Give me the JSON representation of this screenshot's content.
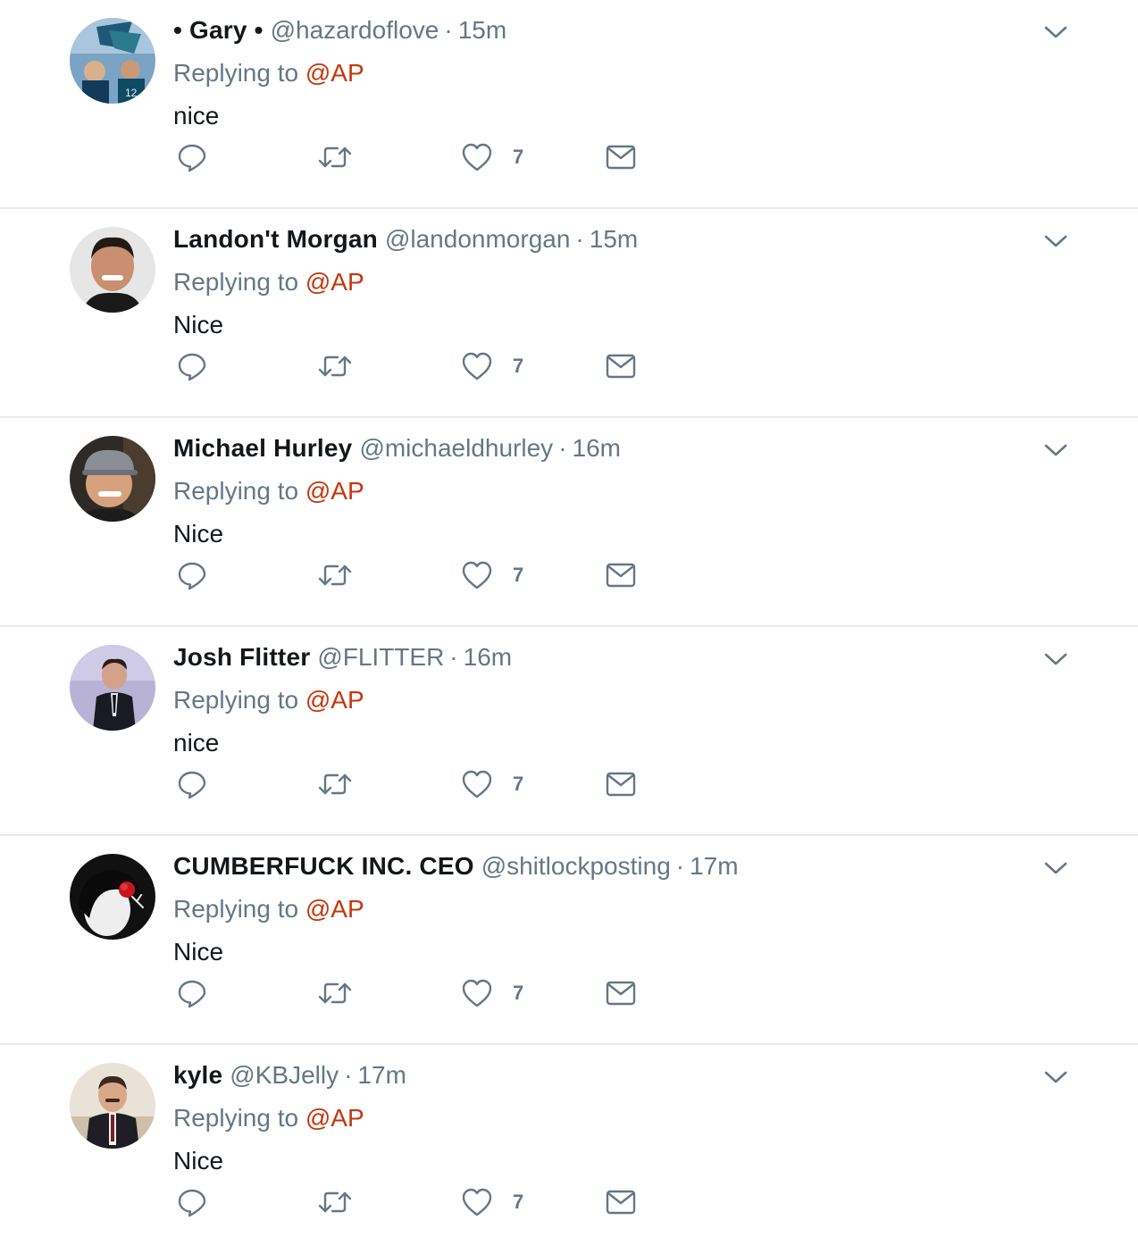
{
  "colors": {
    "name": "#14171a",
    "meta": "#657786",
    "mention": "#c6360b",
    "divider": "#e6ecf0",
    "icon": "#657786"
  },
  "icons": {
    "caret": "chevron-down-icon",
    "reply": "reply-bubble-icon",
    "retweet": "retweet-icon",
    "like": "heart-icon",
    "dm": "envelope-icon"
  },
  "tweets": [
    {
      "name": "• Gary •",
      "handle": "@hazardoflove",
      "sep": "·",
      "time": "15m",
      "replying_prefix": "Replying to",
      "replying_to": "@AP",
      "text": "nice",
      "likes": "7"
    },
    {
      "name": "Landon't Morgan",
      "handle": "@landonmorgan",
      "sep": "·",
      "time": "15m",
      "replying_prefix": "Replying to",
      "replying_to": "@AP",
      "text": "Nice",
      "likes": "7"
    },
    {
      "name": "Michael Hurley",
      "handle": "@michaeldhurley",
      "sep": "·",
      "time": "16m",
      "replying_prefix": "Replying to",
      "replying_to": "@AP",
      "text": "Nice",
      "likes": "7"
    },
    {
      "name": "Josh Flitter",
      "handle": "@FLITTER",
      "sep": "·",
      "time": "16m",
      "replying_prefix": "Replying to",
      "replying_to": "@AP",
      "text": "nice",
      "likes": "7"
    },
    {
      "name": "CUMBERFUCK INC. CEO",
      "handle": "@shitlockposting",
      "sep": "·",
      "time": "17m",
      "replying_prefix": "Replying to",
      "replying_to": "@AP",
      "text": "Nice",
      "likes": "7"
    },
    {
      "name": "kyle",
      "handle": "@KBJelly",
      "sep": "·",
      "time": "17m",
      "replying_prefix": "Replying to",
      "replying_to": "@AP",
      "text": "Nice",
      "likes": "7"
    }
  ]
}
